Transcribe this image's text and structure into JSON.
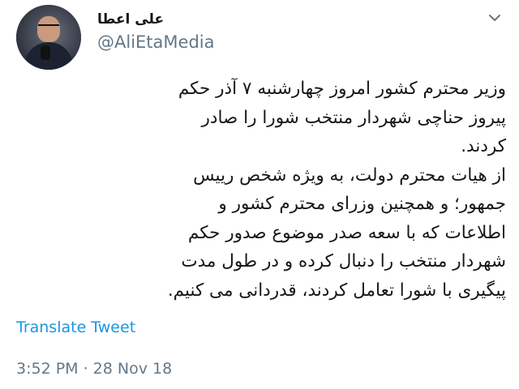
{
  "author": {
    "display_name": "علی اعطا",
    "handle": "@AliEtaMedia"
  },
  "icons": {
    "menu": "chevron-down-icon"
  },
  "tweet": {
    "lines": [
      "وزیر محترم کشور امروز چهارشنبه ۷ آذر حکم",
      "پیروز حناچی شهردار منتخب شورا را صادر",
      "کردند.",
      "از هیات محترم دولت، به ویژه شخص رییس",
      "جمهور؛ و همچنین وزرای محترم کشور و",
      "اطلاعات که با سعه صدر موضوع صدور حکم",
      "شهردار منتخب را دنبال کرده و در طول مدت",
      "پیگیری با شورا تعامل کردند، قدردانی می کنیم."
    ],
    "translate_label": "Translate Tweet",
    "timestamp": "3:52 PM · 28 Nov 18"
  },
  "colors": {
    "link": "#1b95e0",
    "muted": "#657786",
    "text": "#14171a"
  }
}
